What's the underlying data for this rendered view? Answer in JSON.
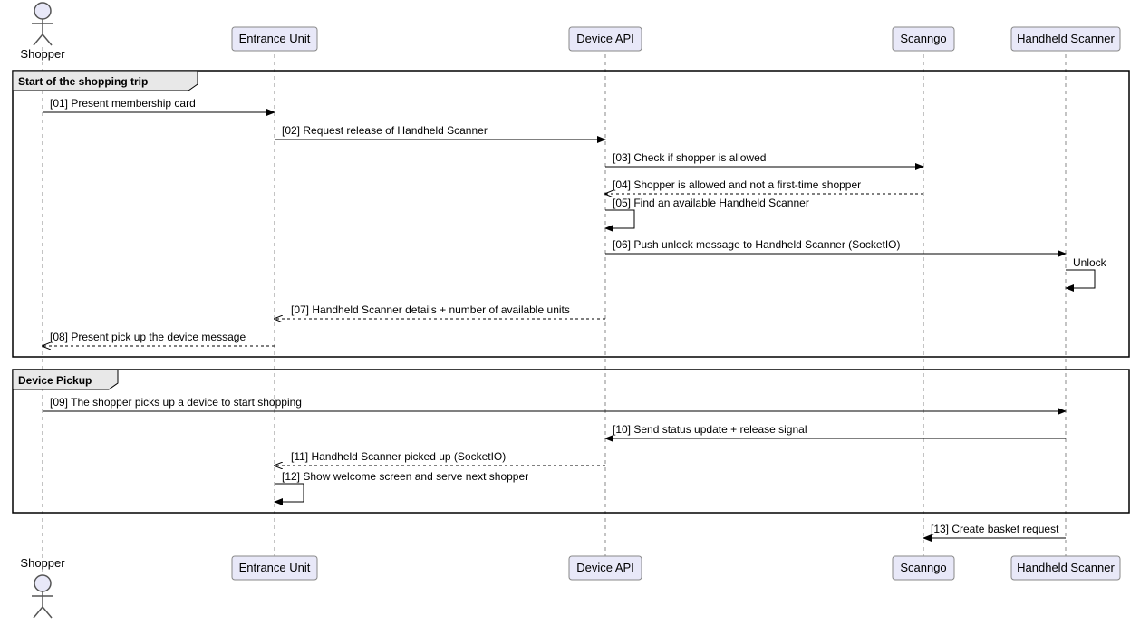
{
  "participants": {
    "shopper": "Shopper",
    "entrance": "Entrance Unit",
    "device_api": "Device API",
    "scanngo": "Scanngo",
    "handheld": "Handheld Scanner"
  },
  "groups": {
    "g1": "Start of the shopping trip",
    "g2": "Device Pickup"
  },
  "messages": {
    "m01": "[01] Present membership card",
    "m02": "[02] Request release of Handheld Scanner",
    "m03": "[03] Check if shopper is allowed",
    "m04": "[04] Shopper is allowed and not a first-time shopper",
    "m05": "[05] Find an available Handheld Scanner",
    "m06": "[06] Push unlock message to Handheld Scanner (SocketIO)",
    "m07": "[07] Handheld Scanner details + number of available units",
    "m08": "[08] Present pick up the device message",
    "m09": "[09] The shopper picks up a device to start shopping",
    "m10": "[10] Send status update + release signal",
    "m11": "[11] Handheld Scanner picked up (SocketIO)",
    "m12": "[12] Show welcome screen and serve next shopper",
    "m13": "[13] Create basket request",
    "unlock": "Unlock"
  }
}
